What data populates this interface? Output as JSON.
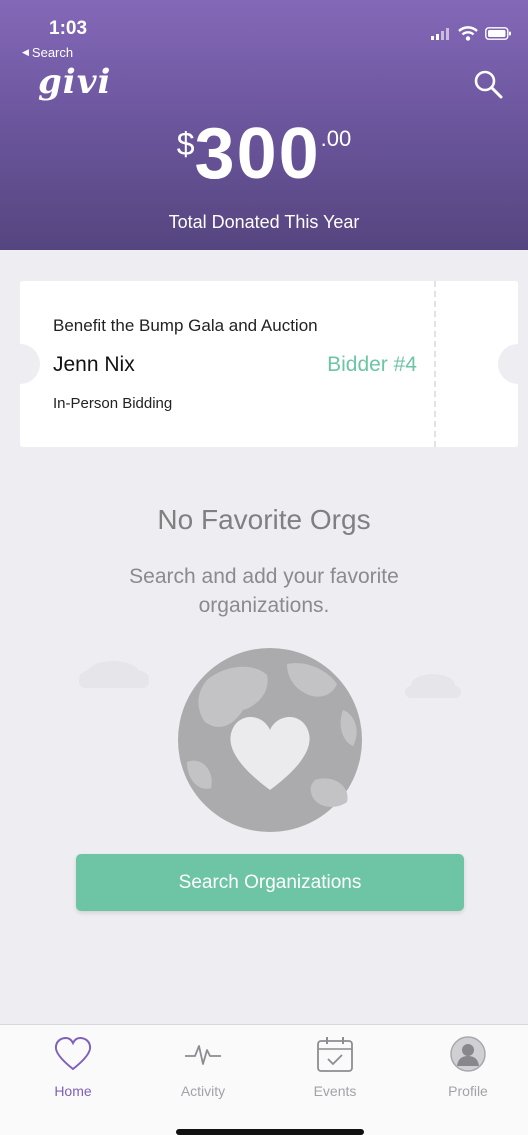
{
  "status_bar": {
    "time": "1:03",
    "back_label": "Search"
  },
  "header": {
    "logo": "givi",
    "amount_currency": "$",
    "amount_integer": "300",
    "amount_decimal": ".00",
    "caption": "Total Donated This Year"
  },
  "ticket": {
    "event_name": "Benefit the Bump Gala and Auction",
    "bidder_name": "Jenn Nix",
    "bidder_number": "Bidder #4",
    "bidding_type": "In-Person Bidding"
  },
  "empty_state": {
    "title": "No Favorite Orgs",
    "description": "Search and add your favorite organizations.",
    "button_label": "Search Organizations"
  },
  "tabs": [
    {
      "label": "Home",
      "icon": "heart-icon",
      "active": true
    },
    {
      "label": "Activity",
      "icon": "pulse-icon",
      "active": false
    },
    {
      "label": "Events",
      "icon": "calendar-icon",
      "active": false
    },
    {
      "label": "Profile",
      "icon": "profile-icon",
      "active": false
    }
  ],
  "colors": {
    "header_top": "#8468b8",
    "header_bottom": "#55457f",
    "accent_green": "#6dc5a6",
    "active_tab": "#7e61b8",
    "background": "#eeeef2"
  }
}
